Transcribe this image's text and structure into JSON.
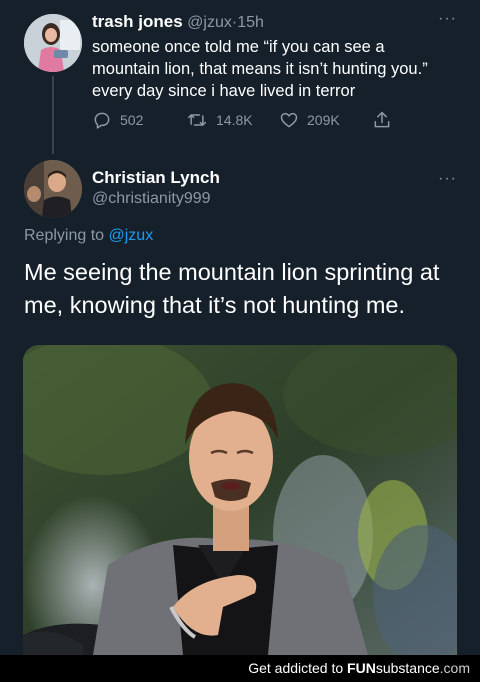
{
  "tweet1": {
    "display_name": "trash jones",
    "handle": "@jzux",
    "separator": "·",
    "time": "15h",
    "more": "···",
    "text": "someone once told me “if you can see a mountain lion, that means it isn’t hunting you.” every day since i have lived in terror",
    "replies": "502",
    "retweets": "14.8K",
    "likes": "209K",
    "icons": [
      "reply-icon",
      "retweet-icon",
      "like-icon",
      "share-icon"
    ]
  },
  "tweet2": {
    "display_name": "Christian Lynch",
    "handle": "@christianity999",
    "more": "···",
    "replying_prefix": "Replying to",
    "replying_to": "@jzux",
    "text": "Me seeing the mountain lion sprinting at me, knowing that it’s not hunting me."
  },
  "footer": {
    "prefix": "Get addicted to ",
    "brand_fun": "FUN",
    "brand_substance": "substance",
    "brand_tld": ".com"
  },
  "colors": {
    "background": "#15202b",
    "secondary_text": "#8b98a5",
    "link": "#1d9bf0",
    "divider": "#38444d"
  }
}
